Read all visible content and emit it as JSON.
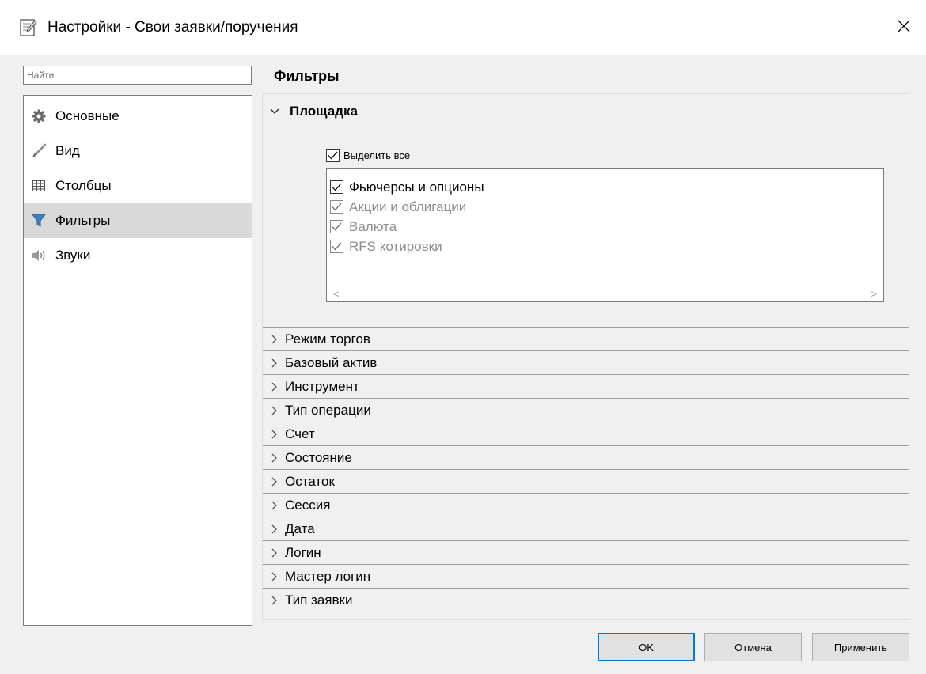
{
  "window": {
    "title": "Настройки - Свои заявки/поручения"
  },
  "search": {
    "placeholder": "Найти"
  },
  "sidebar": {
    "items": [
      {
        "label": "Основные",
        "icon": "gear-icon"
      },
      {
        "label": "Вид",
        "icon": "brush-icon"
      },
      {
        "label": "Столбцы",
        "icon": "table-columns-icon"
      },
      {
        "label": "Фильтры",
        "icon": "filter-icon",
        "selected": true
      },
      {
        "label": "Звуки",
        "icon": "speaker-icon"
      }
    ]
  },
  "main": {
    "section_title": "Фильтры",
    "expanded_group": {
      "label": "Площадка",
      "select_all": {
        "label": "Выделить все",
        "checked": true
      },
      "items": [
        {
          "label": "Фьючерсы и опционы",
          "checked": true
        },
        {
          "label": "Акции и облигации",
          "checked": true
        },
        {
          "label": "Валюта",
          "checked": true
        },
        {
          "label": "RFS котировки",
          "checked": true
        }
      ]
    },
    "groups": [
      "Режим торгов",
      "Базовый актив",
      "Инструмент",
      "Тип операции",
      "Счет",
      "Состояние",
      "Остаток",
      "Сессия",
      "Дата",
      "Логин",
      "Мастер логин",
      "Тип заявки"
    ]
  },
  "buttons": {
    "ok": "OK",
    "cancel": "Отмена",
    "apply": "Применить"
  },
  "colors": {
    "accent": "#0078d7",
    "selected_bg": "#d9d9d9",
    "dim_text": "#8d8d8d"
  }
}
